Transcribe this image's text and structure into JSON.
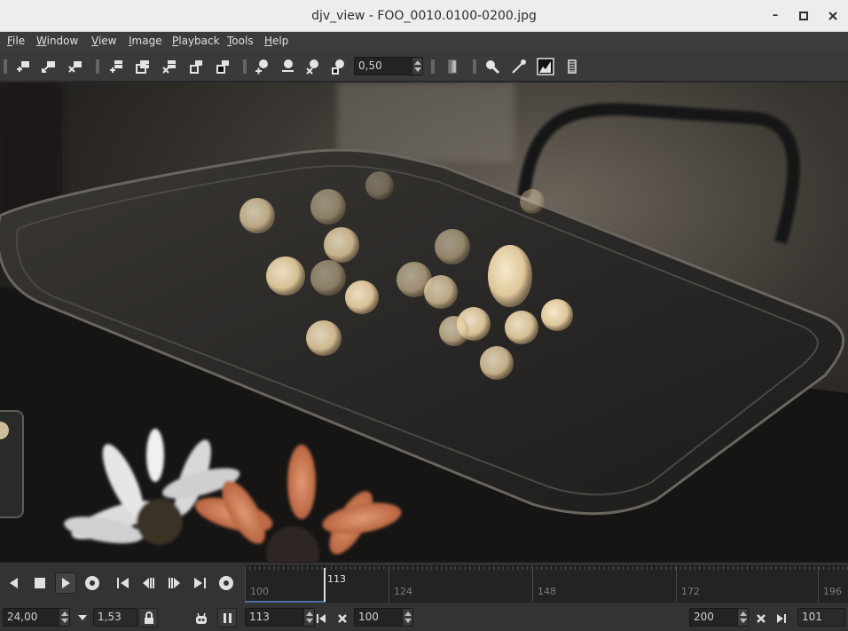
{
  "window": {
    "title": "djv_view - FOO_0010.0100-0200.jpg",
    "minimize_icon": "minimize-icon",
    "maximize_icon": "maximize-icon",
    "close_icon": "close-icon"
  },
  "menu": {
    "items": [
      {
        "label": "File"
      },
      {
        "label": "Window"
      },
      {
        "label": "View"
      },
      {
        "label": "Image"
      },
      {
        "label": "Playback"
      },
      {
        "label": "Tools"
      },
      {
        "label": "Help"
      }
    ]
  },
  "toolbar": {
    "zoom_value": "0,50",
    "icons": [
      "window-new-icon",
      "window-copy-icon",
      "window-close-icon",
      "fit-icon",
      "frame-copy-icon",
      "close-view-icon",
      "frame-icon",
      "frame-fill-icon",
      "zoom-in-icon",
      "zoom-out-icon",
      "zoom-reset-icon",
      "zoom-fit-icon",
      "channel-icon",
      "magnify-icon",
      "color-picker-icon",
      "histogram-icon",
      "info-icon"
    ]
  },
  "playback": {
    "fps": "24,00",
    "speed": "1,53",
    "current_frame": "113",
    "in_point": "100",
    "out_point": "200",
    "duration": "101",
    "timeline": {
      "current_label": "113",
      "tick_labels": [
        "100",
        "124",
        "148",
        "172",
        "196"
      ],
      "start": 100,
      "end": 200,
      "current": 113
    }
  },
  "colors": {
    "accent": "#4a6ea9",
    "background": "#333333"
  }
}
